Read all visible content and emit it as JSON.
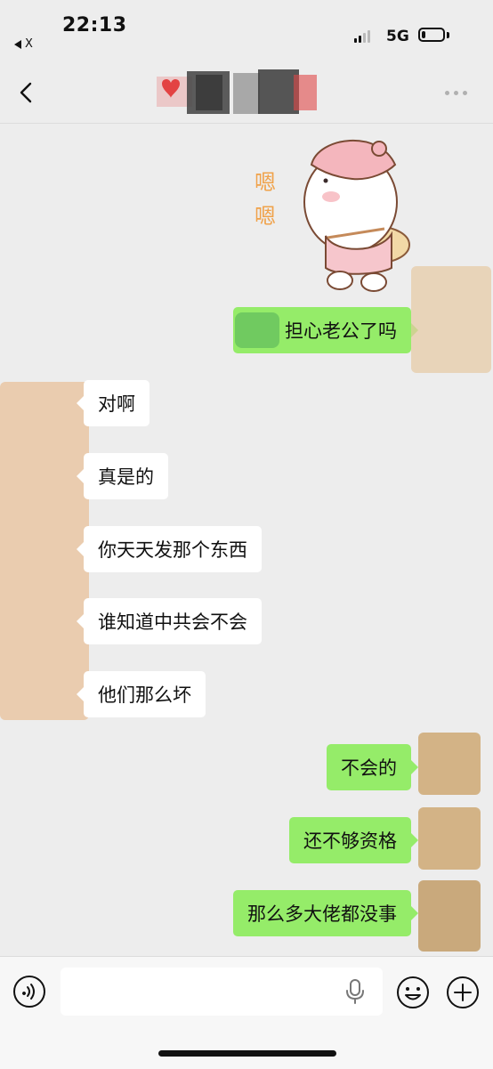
{
  "status_bar": {
    "back_app": "X",
    "time": "22:13",
    "network": "5G",
    "signal_bars_active": 2,
    "battery_fraction": 0.2
  },
  "nav": {
    "back_icon": "chevron-left-icon",
    "more_icon": "ellipsis-icon"
  },
  "sticker": {
    "caption": "嗯嗯"
  },
  "messages": [
    {
      "direction": "out",
      "text": "担心老公了吗"
    },
    {
      "direction": "in",
      "text": "对啊"
    },
    {
      "direction": "in",
      "text": "真是的"
    },
    {
      "direction": "in",
      "text": "你天天发那个东西"
    },
    {
      "direction": "in",
      "text": "谁知道中共会不会"
    },
    {
      "direction": "in",
      "text": "他们那么坏"
    },
    {
      "direction": "out",
      "text": "不会的"
    },
    {
      "direction": "out",
      "text": "还不够资格"
    },
    {
      "direction": "out",
      "text": "那么多大佬都没事"
    }
  ],
  "input_bar": {
    "voice_icon": "voice-mode-icon",
    "mic_icon": "microphone-icon",
    "emoji_icon": "smiley-icon",
    "plus_icon": "plus-icon",
    "value": ""
  },
  "colors": {
    "background": "#ededed",
    "outgoing_bubble": "#95ec69",
    "incoming_bubble": "#ffffff",
    "input_bar": "#f7f7f7"
  }
}
